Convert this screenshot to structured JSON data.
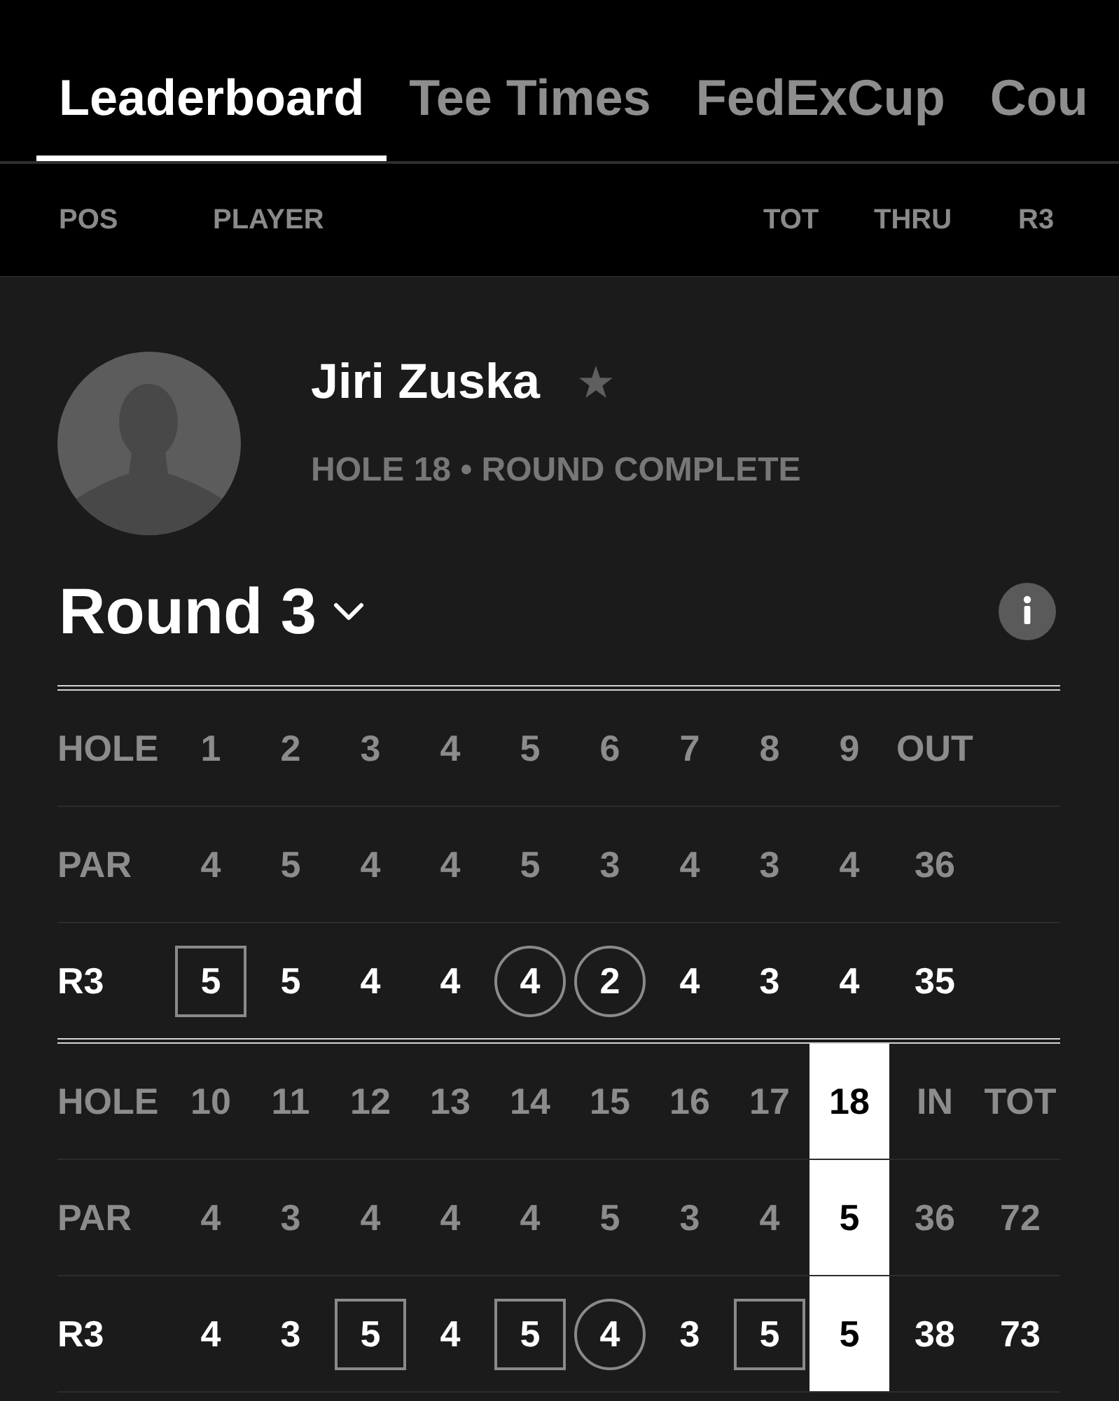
{
  "tabs": [
    {
      "label": "Leaderboard",
      "selected": true
    },
    {
      "label": "Tee Times",
      "selected": false
    },
    {
      "label": "FedExCup",
      "selected": false
    },
    {
      "label": "Cou",
      "selected": false
    }
  ],
  "columns": [
    "POS",
    "PLAYER",
    "TOT",
    "THRU",
    "R3"
  ],
  "player": {
    "name": "Jiri Zuska",
    "favorite": false,
    "status": "HOLE 18 • ROUND COMPLETE"
  },
  "round": {
    "title": "Round 3"
  },
  "scorecard": [
    {
      "labels": {
        "hole": "HOLE",
        "par": "PAR",
        "score": "R3"
      },
      "holes": [
        {
          "hole": "1",
          "par": "4",
          "score": "5",
          "kind": "square",
          "current": false
        },
        {
          "hole": "2",
          "par": "5",
          "score": "5",
          "kind": "plain",
          "current": false
        },
        {
          "hole": "3",
          "par": "4",
          "score": "4",
          "kind": "plain",
          "current": false
        },
        {
          "hole": "4",
          "par": "4",
          "score": "4",
          "kind": "plain",
          "current": false
        },
        {
          "hole": "5",
          "par": "5",
          "score": "4",
          "kind": "circle",
          "current": false
        },
        {
          "hole": "6",
          "par": "3",
          "score": "2",
          "kind": "circle",
          "current": false
        },
        {
          "hole": "7",
          "par": "4",
          "score": "4",
          "kind": "plain",
          "current": false
        },
        {
          "hole": "8",
          "par": "3",
          "score": "3",
          "kind": "plain",
          "current": false
        },
        {
          "hole": "9",
          "par": "4",
          "score": "4",
          "kind": "plain",
          "current": false
        }
      ],
      "totals": [
        {
          "label": "OUT",
          "par": "36",
          "score": "35"
        }
      ]
    },
    {
      "labels": {
        "hole": "HOLE",
        "par": "PAR",
        "score": "R3"
      },
      "holes": [
        {
          "hole": "10",
          "par": "4",
          "score": "4",
          "kind": "plain",
          "current": false
        },
        {
          "hole": "11",
          "par": "3",
          "score": "3",
          "kind": "plain",
          "current": false
        },
        {
          "hole": "12",
          "par": "4",
          "score": "5",
          "kind": "square",
          "current": false
        },
        {
          "hole": "13",
          "par": "4",
          "score": "4",
          "kind": "plain",
          "current": false
        },
        {
          "hole": "14",
          "par": "4",
          "score": "5",
          "kind": "square",
          "current": false
        },
        {
          "hole": "15",
          "par": "5",
          "score": "4",
          "kind": "circle",
          "current": false
        },
        {
          "hole": "16",
          "par": "3",
          "score": "3",
          "kind": "plain",
          "current": false
        },
        {
          "hole": "17",
          "par": "4",
          "score": "5",
          "kind": "square",
          "current": false
        },
        {
          "hole": "18",
          "par": "5",
          "score": "5",
          "kind": "plain",
          "current": true
        }
      ],
      "totals": [
        {
          "label": "IN",
          "par": "36",
          "score": "38"
        },
        {
          "label": "TOT",
          "par": "72",
          "score": "73"
        }
      ]
    }
  ]
}
